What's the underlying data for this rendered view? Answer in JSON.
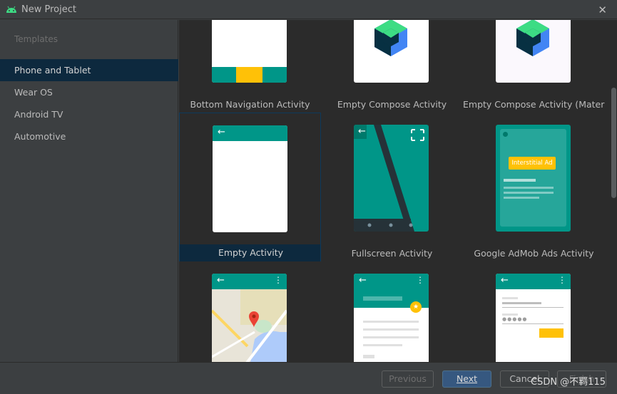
{
  "window": {
    "title": "New Project",
    "close_glyph": "✕"
  },
  "sidebar": {
    "header": "Templates",
    "items": [
      {
        "label": "Phone and Tablet",
        "selected": true
      },
      {
        "label": "Wear OS",
        "selected": false
      },
      {
        "label": "Android TV",
        "selected": false
      },
      {
        "label": "Automotive",
        "selected": false
      }
    ]
  },
  "templates": [
    {
      "label": "Bottom Navigation Activity",
      "icon": "bottom-navigation-preview"
    },
    {
      "label": "Empty Compose Activity",
      "icon": "compose-logo"
    },
    {
      "label": "Empty Compose Activity (Material…",
      "icon": "compose-logo"
    },
    {
      "label": "Empty Activity",
      "icon": "empty-activity-preview",
      "selected": true
    },
    {
      "label": "Fullscreen Activity",
      "icon": "fullscreen-preview"
    },
    {
      "label": "Google AdMob Ads Activity",
      "icon": "admob-preview",
      "ad_badge": "Interstitial Ad"
    },
    {
      "label": "",
      "icon": "google-maps-preview"
    },
    {
      "label": "",
      "icon": "scrolling-preview"
    },
    {
      "label": "",
      "icon": "login-preview"
    }
  ],
  "buttons": {
    "previous": "Previous",
    "next": "Next",
    "cancel": "Cancel",
    "finish": "Finish"
  },
  "watermark": "CSDN @不羁115",
  "colors": {
    "teal": "#009688",
    "teal_dark": "#00796b",
    "amber": "#ffc107",
    "selection": "#0d293e"
  }
}
